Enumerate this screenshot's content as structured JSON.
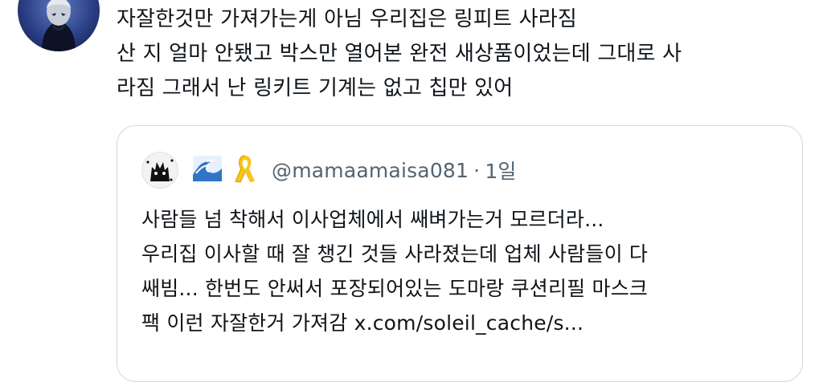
{
  "post": {
    "lines": [
      "자잘한것만 가져가는게 아님 우리집은 링피트 사라짐",
      "산 지 얼마 안됐고 박스만 열어본 완전 새상품이었는데 그대로 사",
      "라짐 그래서 난 링키트 기계는 없고 칩만 있어"
    ]
  },
  "quote": {
    "name_icons": [
      "wave-emoji",
      "yellow-ribbon-emoji"
    ],
    "handle": "@mamaamaisa081",
    "separator": "·",
    "time": "1일",
    "lines": [
      "사람들 넘 착해서 이사업체에서 쌔벼가는거 모르더라...",
      "우리집 이사할 때 잘 챙긴 것들 사라졌는데 업체 사람들이 다",
      "쌔빔... 한번도 안써서 포장되어있는 도마랑 쿠션리필 마스크",
      "팩 이런 자잘한거 가져감 x.com/soleil_cache/s..."
    ]
  },
  "colors": {
    "text": "#0f1419",
    "secondary": "#536471",
    "border": "#cfd9de"
  }
}
